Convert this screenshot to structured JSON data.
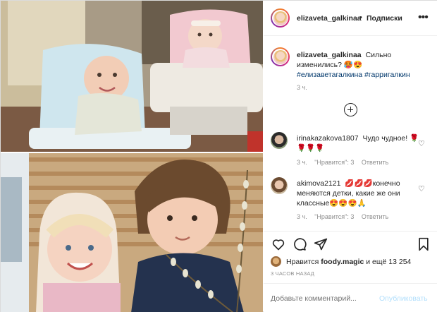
{
  "header": {
    "username": "elizaveta_galkinaa",
    "separator": "•",
    "follow_label": "Подписки",
    "more_label": "•••"
  },
  "caption": {
    "username": "elizaveta_galkinaa",
    "text": "Сильно изменились? 🥵😍",
    "hashtags": "#елизаветагалкина #гарригалкин",
    "time": "3 ч."
  },
  "comments": [
    {
      "username": "irinakazakova1807",
      "text": "Чудо чудное! 🌹🌹🌹🌹",
      "time": "3 ч.",
      "likes": "\"Нравится\": 3",
      "reply": "Ответить"
    },
    {
      "username": "akimova2121",
      "text": "💋💋💋конечно меняются детки, какие же они классные😍😍😍🙏",
      "time": "3 ч.",
      "likes": "\"Нравится\": 3",
      "reply": "Ответить"
    }
  ],
  "likes": {
    "prefix": "Нравится",
    "user": "foody.magic",
    "suffix": "и ещё 13 254"
  },
  "post_time": "3 ЧАСОВ НАЗАД",
  "comment_box": {
    "placeholder": "Добавьте комментарий...",
    "publish_label": "Опубликовать"
  },
  "colors": {
    "link": "#00376b",
    "muted": "#8e8e8e",
    "publish_disabled": "#b2dffc"
  }
}
